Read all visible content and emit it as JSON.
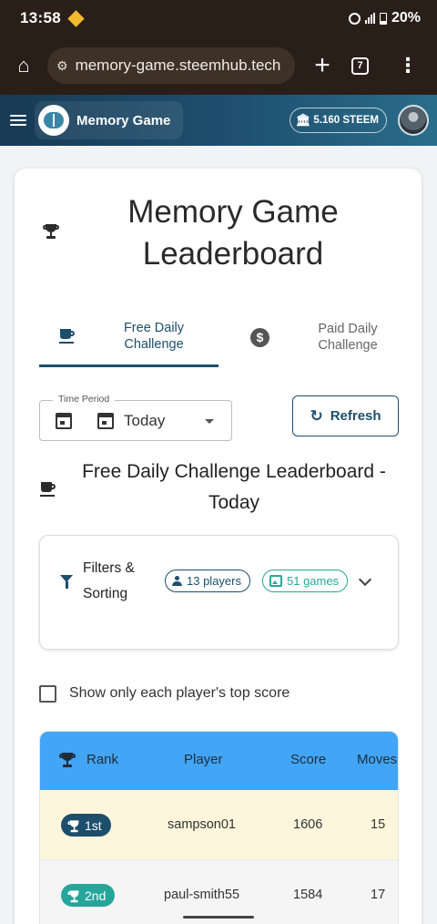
{
  "status_bar": {
    "time": "13:58",
    "battery": "20%"
  },
  "browser": {
    "url": "memory-game.steemhub.tech",
    "tab_count": "7"
  },
  "app_bar": {
    "title": "Memory Game",
    "wallet": "5.160 STEEM"
  },
  "page": {
    "title": "Memory Game Leaderboard",
    "tabs": [
      {
        "label": "Free Daily Challenge",
        "active": true
      },
      {
        "label": "Paid Daily Challenge",
        "active": false
      }
    ],
    "time_period": {
      "label": "Time Period",
      "value": "Today"
    },
    "refresh_label": "Refresh",
    "section_title": "Free Daily Challenge Leaderboard - Today",
    "filters": {
      "title": "Filters & Sorting",
      "players_chip": "13 players",
      "games_chip": "51 games"
    },
    "top_score_checkbox": {
      "label": "Show only each player's top score",
      "checked": false
    }
  },
  "table": {
    "columns": [
      "Rank",
      "Player",
      "Score",
      "Moves"
    ],
    "rows": [
      {
        "rank": "1st",
        "player": "sampson01",
        "score": "1606",
        "moves": "15"
      },
      {
        "rank": "2nd",
        "player": "paul-smith55",
        "score": "1584",
        "moves": "17"
      }
    ]
  },
  "colors": {
    "primary": "#1d4e6b",
    "accent": "#26a69a",
    "table_header": "#42a5f5",
    "first_row": "#fdf6dc"
  }
}
